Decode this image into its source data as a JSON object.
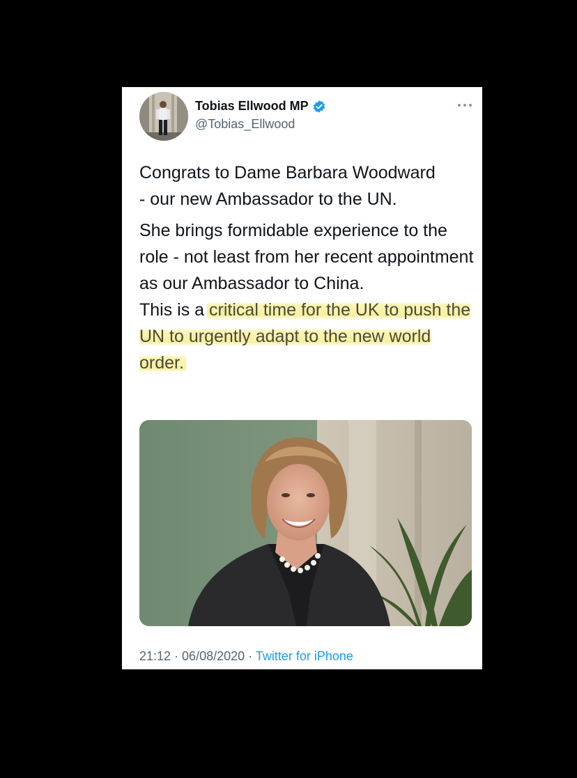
{
  "tweet": {
    "author": {
      "display_name": "Tobias Ellwood MP",
      "handle": "@Tobias_Ellwood",
      "verified": true,
      "avatar_icon": "profile-photo"
    },
    "more_icon": "more-options-icon",
    "text": {
      "paragraph1_line1": "Congrats to Dame Barbara Woodward",
      "paragraph1_line2": "- our new Ambassador to the UN.",
      "paragraph2": "She brings formidable experience to the role - not least from her recent appointment as our Ambassador to China.",
      "paragraph3_prefix": "This is a ",
      "paragraph3_highlighted": "critical time for the UK to push the UN to urgently adapt to the new world order."
    },
    "media_icon": "portrait-photo",
    "meta": {
      "time": "21:12",
      "separator1": " · ",
      "date": "06/08/2020",
      "separator2": " · ",
      "source": "Twitter for iPhone"
    }
  },
  "colors": {
    "background": "#000000",
    "card": "#ffffff",
    "text_primary": "#0f1419",
    "text_secondary": "#536471",
    "link": "#1d9bf0",
    "verified_badge": "#1d9bf0",
    "highlight": "#f8f0a0"
  }
}
